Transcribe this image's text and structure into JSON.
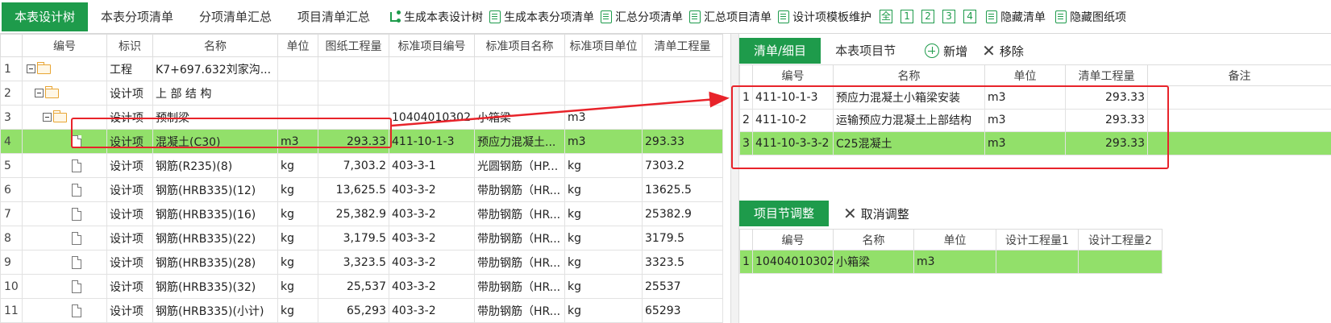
{
  "toolbar": {
    "tabs": [
      "本表设计树",
      "本表分项清单",
      "分项清单汇总",
      "项目清单汇总"
    ],
    "tools": [
      "生成本表设计树",
      "生成本表分项清单",
      "汇总分项清单",
      "汇总项目清单",
      "设计项模板维护"
    ],
    "levels": [
      "全",
      "1",
      "2",
      "3",
      "4"
    ],
    "hide_list": "隐藏清单",
    "hide_drawing": "隐藏图纸项"
  },
  "left_grid": {
    "headers": [
      "编号",
      "标识",
      "名称",
      "单位",
      "图纸工程量",
      "标准项目编号",
      "标准项目名称",
      "标准项目单位",
      "清单工程量"
    ],
    "rows": [
      {
        "idx": "1",
        "type": "工程",
        "name": "K7+697.632刘家沟...",
        "unit": "",
        "qty": "",
        "std_code": "",
        "std_name": "",
        "std_unit": "",
        "list_qty": ""
      },
      {
        "idx": "2",
        "type": "设计项",
        "name": "上 部 结 构",
        "unit": "",
        "qty": "",
        "std_code": "",
        "std_name": "",
        "std_unit": "",
        "list_qty": ""
      },
      {
        "idx": "3",
        "type": "设计项",
        "name": "预制梁",
        "unit": "",
        "qty": "",
        "std_code": "10404010302",
        "std_name": "小箱梁",
        "std_unit": "m3",
        "list_qty": ""
      },
      {
        "idx": "4",
        "type": "设计项",
        "name": "混凝土(C30)",
        "unit": "m3",
        "qty": "293.33",
        "std_code": "411-10-1-3",
        "std_name": "预应力混凝土...",
        "std_unit": "m3",
        "list_qty": "293.33"
      },
      {
        "idx": "5",
        "type": "设计项",
        "name": "钢筋(R235)(8)",
        "unit": "kg",
        "qty": "7,303.2",
        "std_code": "403-3-1",
        "std_name": "光圆钢筋（HP...",
        "std_unit": "kg",
        "list_qty": "7303.2"
      },
      {
        "idx": "6",
        "type": "设计项",
        "name": "钢筋(HRB335)(12)",
        "unit": "kg",
        "qty": "13,625.5",
        "std_code": "403-3-2",
        "std_name": "带肋钢筋（HR...",
        "std_unit": "kg",
        "list_qty": "13625.5"
      },
      {
        "idx": "7",
        "type": "设计项",
        "name": "钢筋(HRB335)(16)",
        "unit": "kg",
        "qty": "25,382.9",
        "std_code": "403-3-2",
        "std_name": "带肋钢筋（HR...",
        "std_unit": "kg",
        "list_qty": "25382.9"
      },
      {
        "idx": "8",
        "type": "设计项",
        "name": "钢筋(HRB335)(22)",
        "unit": "kg",
        "qty": "3,179.5",
        "std_code": "403-3-2",
        "std_name": "带肋钢筋（HR...",
        "std_unit": "kg",
        "list_qty": "3179.5"
      },
      {
        "idx": "9",
        "type": "设计项",
        "name": "钢筋(HRB335)(28)",
        "unit": "kg",
        "qty": "3,323.5",
        "std_code": "403-3-2",
        "std_name": "带肋钢筋（HR...",
        "std_unit": "kg",
        "list_qty": "3323.5"
      },
      {
        "idx": "10",
        "type": "设计项",
        "name": "钢筋(HRB335)(32)",
        "unit": "kg",
        "qty": "25,537",
        "std_code": "403-3-2",
        "std_name": "带肋钢筋（HR...",
        "std_unit": "kg",
        "list_qty": "25537"
      },
      {
        "idx": "11",
        "type": "设计项",
        "name": "钢筋(HRB335)(小计)",
        "unit": "kg",
        "qty": "65,293",
        "std_code": "403-3-2",
        "std_name": "带肋钢筋（HR...",
        "std_unit": "kg",
        "list_qty": "65293"
      }
    ]
  },
  "list_panel": {
    "tabs": [
      "清单/细目",
      "本表项目节"
    ],
    "add_label": "新增",
    "remove_label": "移除",
    "headers": [
      "编号",
      "名称",
      "单位",
      "清单工程量",
      "备注"
    ],
    "rows": [
      {
        "idx": "1",
        "code": "411-10-1-3",
        "name": "预应力混凝土小箱梁安装",
        "unit": "m3",
        "qty": "293.33",
        "note": ""
      },
      {
        "idx": "2",
        "code": "411-10-2",
        "name": "运输预应力混凝土上部结构",
        "unit": "m3",
        "qty": "293.33",
        "note": ""
      },
      {
        "idx": "3",
        "code": "411-10-3-3-2",
        "name": "C25混凝土",
        "unit": "m3",
        "qty": "293.33",
        "note": ""
      }
    ]
  },
  "adjust_panel": {
    "tab": "项目节调整",
    "cancel_label": "取消调整",
    "headers": [
      "编号",
      "名称",
      "单位",
      "设计工程量1",
      "设计工程量2"
    ],
    "rows": [
      {
        "idx": "1",
        "code": "10404010302",
        "name": "小箱梁",
        "unit": "m3",
        "qty1": "",
        "qty2": ""
      }
    ]
  },
  "colors": {
    "accent": "#1e9b4b",
    "selected_row": "#92e06a",
    "highlight": "#e8232a"
  }
}
